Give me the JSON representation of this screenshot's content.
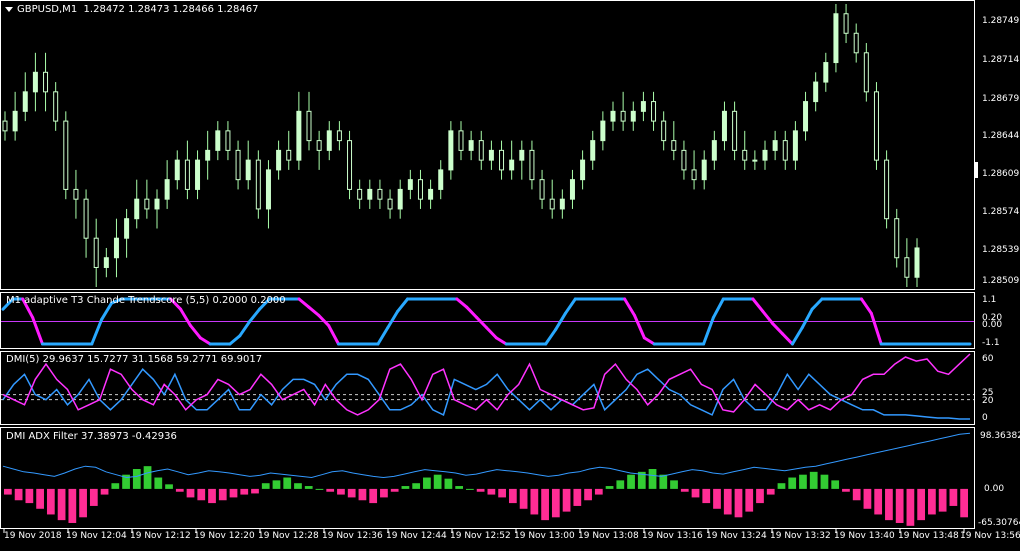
{
  "main": {
    "symbol": "GBPUSD,M1",
    "ohlc": "1.28472 1.28473 1.28466 1.28467",
    "price_axis": [
      "1.28749",
      "1.28714",
      "1.28679",
      "1.28644",
      "1.28609",
      "1.28574",
      "1.28539",
      "1.28509"
    ],
    "ymin": 1.2849,
    "ymax": 1.2878,
    "candles": [
      [
        1.2866,
        1.2867,
        1.2864,
        1.2865
      ],
      [
        1.2865,
        1.2869,
        1.2864,
        1.2867
      ],
      [
        1.2867,
        1.2871,
        1.2866,
        1.2869
      ],
      [
        1.2869,
        1.2873,
        1.2867,
        1.2871
      ],
      [
        1.2871,
        1.2873,
        1.2867,
        1.2869
      ],
      [
        1.2869,
        1.287,
        1.2865,
        1.2866
      ],
      [
        1.2866,
        1.2867,
        1.2858,
        1.2859
      ],
      [
        1.2859,
        1.2861,
        1.2856,
        1.2858
      ],
      [
        1.2858,
        1.2859,
        1.2852,
        1.2854
      ],
      [
        1.2854,
        1.2856,
        1.2849,
        1.2851
      ],
      [
        1.2851,
        1.2853,
        1.285,
        1.2852
      ],
      [
        1.2852,
        1.2856,
        1.285,
        1.2854
      ],
      [
        1.2854,
        1.2857,
        1.2852,
        1.2856
      ],
      [
        1.2856,
        1.286,
        1.2855,
        1.2858
      ],
      [
        1.2858,
        1.286,
        1.2856,
        1.2857
      ],
      [
        1.2857,
        1.2859,
        1.2855,
        1.2858
      ],
      [
        1.2858,
        1.2862,
        1.2857,
        1.286
      ],
      [
        1.286,
        1.2863,
        1.2859,
        1.2862
      ],
      [
        1.2862,
        1.2864,
        1.2858,
        1.2859
      ],
      [
        1.2859,
        1.2863,
        1.2858,
        1.2862
      ],
      [
        1.2862,
        1.2865,
        1.286,
        1.2863
      ],
      [
        1.2863,
        1.2866,
        1.2862,
        1.2865
      ],
      [
        1.2865,
        1.2866,
        1.2862,
        1.2863
      ],
      [
        1.2863,
        1.2864,
        1.2859,
        1.286
      ],
      [
        1.286,
        1.2864,
        1.2859,
        1.2862
      ],
      [
        1.2862,
        1.2863,
        1.2856,
        1.2857
      ],
      [
        1.2857,
        1.2862,
        1.2855,
        1.2861
      ],
      [
        1.2861,
        1.2864,
        1.286,
        1.2863
      ],
      [
        1.2863,
        1.2865,
        1.2861,
        1.2862
      ],
      [
        1.2862,
        1.2869,
        1.2861,
        1.2867
      ],
      [
        1.2867,
        1.2869,
        1.2863,
        1.2864
      ],
      [
        1.2864,
        1.2865,
        1.2861,
        1.2863
      ],
      [
        1.2863,
        1.2866,
        1.2862,
        1.2865
      ],
      [
        1.2865,
        1.2866,
        1.2863,
        1.2864
      ],
      [
        1.2864,
        1.2865,
        1.2858,
        1.2859
      ],
      [
        1.2859,
        1.286,
        1.2857,
        1.2858
      ],
      [
        1.2858,
        1.286,
        1.2857,
        1.2859
      ],
      [
        1.2859,
        1.286,
        1.2857,
        1.2858
      ],
      [
        1.2858,
        1.2859,
        1.2856,
        1.2857
      ],
      [
        1.2857,
        1.286,
        1.2856,
        1.2859
      ],
      [
        1.2859,
        1.2861,
        1.2858,
        1.286
      ],
      [
        1.286,
        1.2861,
        1.2857,
        1.2858
      ],
      [
        1.2858,
        1.286,
        1.2857,
        1.2859
      ],
      [
        1.2859,
        1.2862,
        1.2858,
        1.2861
      ],
      [
        1.2861,
        1.2866,
        1.286,
        1.2865
      ],
      [
        1.2865,
        1.2866,
        1.2862,
        1.2863
      ],
      [
        1.2863,
        1.2865,
        1.2862,
        1.2864
      ],
      [
        1.2864,
        1.2865,
        1.2861,
        1.2862
      ],
      [
        1.2862,
        1.2864,
        1.2861,
        1.2863
      ],
      [
        1.2863,
        1.2864,
        1.286,
        1.2861
      ],
      [
        1.2861,
        1.2864,
        1.286,
        1.2862
      ],
      [
        1.2862,
        1.2864,
        1.286,
        1.2863
      ],
      [
        1.2863,
        1.2864,
        1.2859,
        1.286
      ],
      [
        1.286,
        1.2861,
        1.2857,
        1.2858
      ],
      [
        1.2858,
        1.286,
        1.2856,
        1.2857
      ],
      [
        1.2857,
        1.2859,
        1.2856,
        1.2858
      ],
      [
        1.2858,
        1.2861,
        1.2857,
        1.286
      ],
      [
        1.286,
        1.2863,
        1.2859,
        1.2862
      ],
      [
        1.2862,
        1.2865,
        1.2861,
        1.2864
      ],
      [
        1.2864,
        1.2867,
        1.2863,
        1.2866
      ],
      [
        1.2866,
        1.2868,
        1.2865,
        1.2867
      ],
      [
        1.2867,
        1.2869,
        1.2865,
        1.2866
      ],
      [
        1.2866,
        1.2868,
        1.2865,
        1.2867
      ],
      [
        1.2867,
        1.2869,
        1.2866,
        1.2868
      ],
      [
        1.2868,
        1.2869,
        1.2865,
        1.2866
      ],
      [
        1.2866,
        1.2867,
        1.2863,
        1.2864
      ],
      [
        1.2864,
        1.2866,
        1.2862,
        1.2863
      ],
      [
        1.2863,
        1.2864,
        1.286,
        1.2861
      ],
      [
        1.2861,
        1.2863,
        1.2859,
        1.286
      ],
      [
        1.286,
        1.2863,
        1.2859,
        1.2862
      ],
      [
        1.2862,
        1.2865,
        1.2861,
        1.2864
      ],
      [
        1.2864,
        1.2868,
        1.2863,
        1.2867
      ],
      [
        1.2867,
        1.2868,
        1.2862,
        1.2863
      ],
      [
        1.2863,
        1.2865,
        1.2861,
        1.2862
      ],
      [
        1.2862,
        1.2863,
        1.2861,
        1.2862
      ],
      [
        1.2862,
        1.2864,
        1.2861,
        1.2863
      ],
      [
        1.2863,
        1.2865,
        1.2862,
        1.2864
      ],
      [
        1.2864,
        1.2865,
        1.2861,
        1.2862
      ],
      [
        1.2862,
        1.2866,
        1.2861,
        1.2865
      ],
      [
        1.2865,
        1.2869,
        1.2864,
        1.2868
      ],
      [
        1.2868,
        1.2871,
        1.2867,
        1.287
      ],
      [
        1.287,
        1.2873,
        1.2869,
        1.2872
      ],
      [
        1.2872,
        1.2878,
        1.2871,
        1.2877
      ],
      [
        1.2877,
        1.2878,
        1.2874,
        1.2875
      ],
      [
        1.2875,
        1.2876,
        1.2872,
        1.2873
      ],
      [
        1.2873,
        1.2874,
        1.2868,
        1.2869
      ],
      [
        1.2869,
        1.287,
        1.2861,
        1.2862
      ],
      [
        1.2862,
        1.2863,
        1.2855,
        1.2856
      ],
      [
        1.2856,
        1.2857,
        1.2851,
        1.2852
      ],
      [
        1.2852,
        1.2854,
        1.2849,
        1.285
      ],
      [
        1.285,
        1.2854,
        1.2849,
        1.2853
      ]
    ]
  },
  "t3": {
    "label": "M1  adaptive T3 Chande Trendscore (5,5) 0.2000 0.2000",
    "axis": [
      "1.1",
      "0.20",
      "0.00",
      "-1.1"
    ],
    "line_colors": [
      "#29a9ff",
      "#ff1aff",
      "#c838f8"
    ],
    "values": [
      0.6,
      1.1,
      1.1,
      0.2,
      -1.1,
      -1.1,
      -1.1,
      -1.1,
      -1.1,
      -1.1,
      0.1,
      0.9,
      1.1,
      1.1,
      1.1,
      1.1,
      1.1,
      1.1,
      0.6,
      -0.2,
      -0.8,
      -1.1,
      -1.1,
      -1.1,
      -0.7,
      0.0,
      0.6,
      1.1,
      1.1,
      1.1,
      1.1,
      0.7,
      0.3,
      -0.2,
      -1.1,
      -1.1,
      -1.1,
      -1.1,
      -1.1,
      -0.3,
      0.5,
      1.1,
      1.1,
      1.1,
      1.1,
      1.1,
      1.1,
      0.7,
      0.2,
      -0.3,
      -0.8,
      -1.1,
      -1.1,
      -1.1,
      -1.1,
      -1.1,
      -0.4,
      0.4,
      1.1,
      1.1,
      1.1,
      1.1,
      1.1,
      1.1,
      0.3,
      -0.8,
      -1.1,
      -1.1,
      -1.1,
      -1.1,
      -1.1,
      -1.1,
      0.2,
      1.1,
      1.1,
      1.1,
      1.1,
      0.5,
      -0.1,
      -0.6,
      -1.1,
      -0.3,
      0.6,
      1.1,
      1.1,
      1.1,
      1.1,
      1.1,
      0.4,
      -1.1,
      -1.1,
      -1.1,
      -1.1,
      -1.1,
      -1.1,
      -1.1,
      -1.1,
      -1.1,
      -1.1
    ]
  },
  "dmi": {
    "label": "DMI(5) 29.9637 15.7277 31.1568 59.2771 69.9017",
    "axis": [
      "60",
      "25",
      "20",
      "0"
    ],
    "plus_di": [
      20,
      35,
      45,
      25,
      20,
      30,
      15,
      25,
      40,
      20,
      10,
      20,
      35,
      50,
      40,
      25,
      45,
      20,
      10,
      10,
      20,
      30,
      10,
      10,
      25,
      15,
      30,
      40,
      40,
      35,
      20,
      35,
      45,
      45,
      40,
      25,
      10,
      10,
      15,
      25,
      10,
      5,
      40,
      35,
      30,
      35,
      45,
      30,
      20,
      10,
      20,
      10,
      20,
      15,
      25,
      35,
      10,
      20,
      30,
      45,
      50,
      40,
      30,
      25,
      15,
      10,
      5,
      30,
      40,
      20,
      10,
      10,
      25,
      45,
      30,
      45,
      35,
      25,
      20,
      15,
      10,
      10,
      5,
      5,
      5,
      4,
      3,
      2,
      2,
      1,
      1
    ],
    "minus_di": [
      25,
      20,
      15,
      40,
      55,
      40,
      30,
      10,
      15,
      20,
      50,
      45,
      30,
      20,
      15,
      35,
      25,
      10,
      20,
      25,
      40,
      35,
      25,
      30,
      45,
      35,
      20,
      25,
      30,
      15,
      35,
      20,
      10,
      5,
      10,
      20,
      50,
      55,
      40,
      20,
      45,
      50,
      20,
      15,
      10,
      20,
      10,
      25,
      35,
      55,
      30,
      25,
      20,
      15,
      10,
      12,
      45,
      55,
      40,
      30,
      15,
      25,
      40,
      45,
      50,
      35,
      30,
      10,
      8,
      20,
      35,
      25,
      15,
      10,
      20,
      10,
      15,
      10,
      20,
      25,
      40,
      45,
      45,
      55,
      62,
      58,
      60,
      48,
      45,
      55,
      65
    ]
  },
  "adx": {
    "label": "DMI ADX Filter 37.38973 -0.42936",
    "axis": [
      "98.36382",
      "0.00",
      "-65.30764"
    ],
    "line": [
      40,
      35,
      30,
      28,
      25,
      22,
      28,
      35,
      40,
      38,
      30,
      25,
      20,
      22,
      28,
      32,
      35,
      30,
      25,
      28,
      32,
      30,
      28,
      25,
      22,
      24,
      28,
      26,
      24,
      22,
      20,
      25,
      30,
      32,
      28,
      25,
      22,
      20,
      22,
      26,
      30,
      34,
      32,
      30,
      28,
      24,
      26,
      30,
      34,
      32,
      30,
      28,
      25,
      22,
      24,
      28,
      30,
      35,
      38,
      36,
      32,
      28,
      26,
      24,
      22,
      26,
      30,
      34,
      32,
      28,
      26,
      30,
      34,
      38,
      36,
      34,
      32,
      35,
      38,
      40,
      44,
      48,
      52,
      56,
      60,
      64,
      68,
      72,
      76,
      80,
      84,
      88,
      92,
      96,
      98
    ],
    "hist": [
      -10,
      -20,
      -25,
      -35,
      -45,
      -55,
      -60,
      -50,
      -30,
      -10,
      10,
      25,
      35,
      40,
      20,
      8,
      -5,
      -15,
      -20,
      -25,
      -20,
      -15,
      -10,
      -8,
      10,
      15,
      20,
      10,
      5,
      0,
      -5,
      -10,
      -15,
      -20,
      -25,
      -15,
      -5,
      5,
      10,
      20,
      25,
      18,
      5,
      0,
      -5,
      -10,
      -15,
      -25,
      -35,
      -45,
      -55,
      -50,
      -40,
      -30,
      -20,
      -10,
      5,
      15,
      25,
      30,
      35,
      25,
      15,
      -5,
      -15,
      -25,
      -35,
      -45,
      -50,
      -40,
      -25,
      -10,
      10,
      20,
      25,
      30,
      25,
      15,
      -5,
      -20,
      -35,
      -45,
      -55,
      -60,
      -65,
      -55,
      -45,
      -40,
      -30,
      -50
    ]
  },
  "time_axis": [
    "19 Nov 2018",
    "19 Nov 12:04",
    "19 Nov 12:12",
    "19 Nov 12:20",
    "19 Nov 12:28",
    "19 Nov 12:36",
    "19 Nov 12:44",
    "19 Nov 12:52",
    "19 Nov 13:00",
    "19 Nov 13:08",
    "19 Nov 13:16",
    "19 Nov 13:24",
    "19 Nov 13:32",
    "19 Nov 13:40",
    "19 Nov 13:48",
    "19 Nov 13:56"
  ]
}
